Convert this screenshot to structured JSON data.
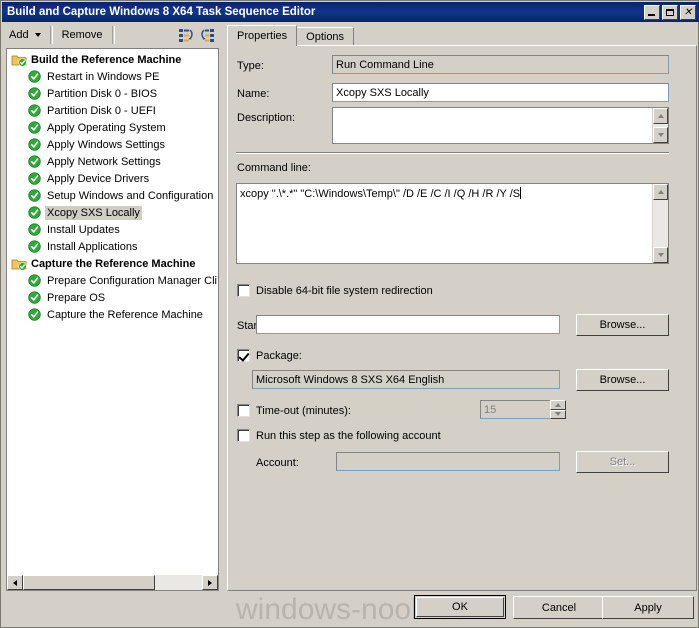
{
  "window": {
    "title": "Build and Capture Windows 8 X64 Task Sequence Editor",
    "minimize_label": "_",
    "maximize_label": "",
    "close_label": "✕"
  },
  "toolbar": {
    "add_label": "Add",
    "remove_label": "Remove",
    "icon_collapse_name": "collapse-all-icon",
    "icon_expand_name": "expand-all-icon"
  },
  "tree": {
    "nodes": [
      {
        "label": "Build the Reference Machine",
        "type": "group"
      },
      {
        "label": "Restart in Windows PE",
        "type": "step"
      },
      {
        "label": "Partition Disk 0 - BIOS",
        "type": "step"
      },
      {
        "label": "Partition Disk 0 - UEFI",
        "type": "step"
      },
      {
        "label": "Apply Operating System",
        "type": "step"
      },
      {
        "label": "Apply Windows Settings",
        "type": "step"
      },
      {
        "label": "Apply Network Settings",
        "type": "step"
      },
      {
        "label": "Apply Device Drivers",
        "type": "step"
      },
      {
        "label": "Setup Windows and Configuration",
        "type": "step"
      },
      {
        "label": "Xcopy SXS Locally",
        "type": "step",
        "selected": true
      },
      {
        "label": "Install Updates",
        "type": "step"
      },
      {
        "label": "Install Applications",
        "type": "step"
      },
      {
        "label": "Capture the Reference Machine",
        "type": "group"
      },
      {
        "label": "Prepare Configuration Manager Cli",
        "type": "step"
      },
      {
        "label": "Prepare OS",
        "type": "step"
      },
      {
        "label": "Capture the Reference Machine",
        "type": "step"
      }
    ]
  },
  "tabs": {
    "properties_label": "Properties",
    "options_label": "Options"
  },
  "form": {
    "type_label": "Type:",
    "type_value": "Run Command Line",
    "name_label": "Name:",
    "name_value": "Xcopy SXS Locally",
    "description_label": "Description:",
    "description_value": "",
    "command_line_label": "Command line:",
    "command_line_value": "xcopy \".\\*.*\" \"C:\\Windows\\Temp\\\" /D /E /C /I /Q /H /R /Y /S",
    "disable_redirection_label": "Disable 64-bit file system redirection",
    "disable_redirection_checked": false,
    "start_in_label": "Start in:",
    "start_in_value": "",
    "start_in_browse_label": "Browse...",
    "package_label": "Package:",
    "package_checked": true,
    "package_value": "Microsoft Windows 8 SXS X64 English",
    "package_browse_label": "Browse...",
    "timeout_label": "Time-out (minutes):",
    "timeout_checked": false,
    "timeout_value": "15",
    "run_as_label": "Run this step as the following account",
    "run_as_checked": false,
    "account_label": "Account:",
    "account_value": "",
    "account_set_label": "Set..."
  },
  "footer": {
    "ok_label": "OK",
    "cancel_label": "Cancel",
    "apply_label": "Apply",
    "watermark": "windows-noob.com"
  }
}
